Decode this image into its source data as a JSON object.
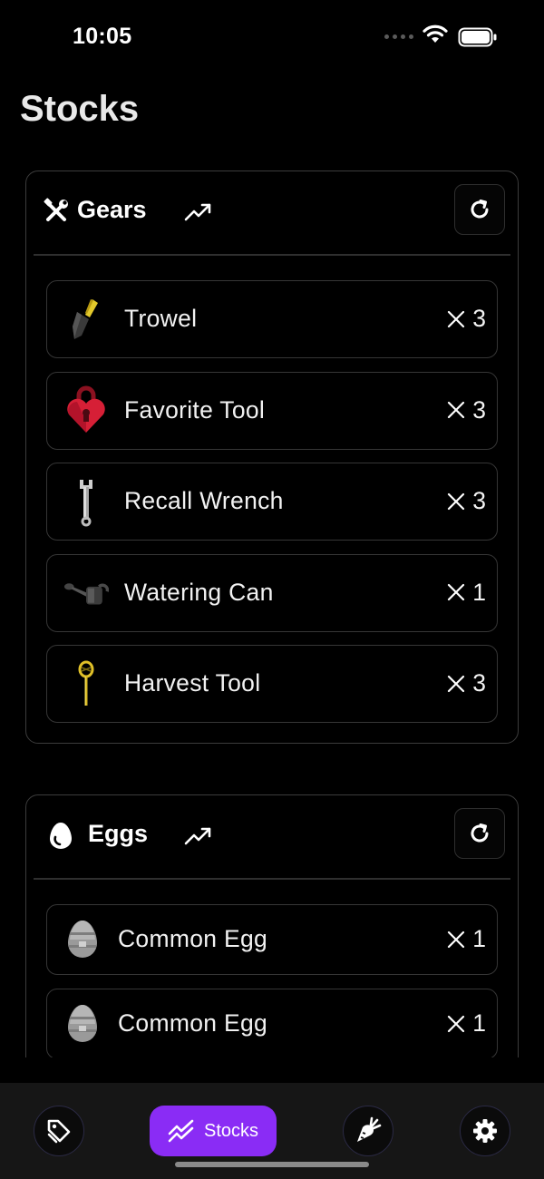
{
  "status_bar": {
    "time": "10:05"
  },
  "page": {
    "title": "Stocks"
  },
  "gears": {
    "title": "Gears",
    "icon": "tools-icon",
    "items": [
      {
        "name": "Trowel",
        "qty": "3",
        "icon": "trowel-icon"
      },
      {
        "name": "Favorite Tool",
        "qty": "3",
        "icon": "heart-lock-icon"
      },
      {
        "name": "Recall Wrench",
        "qty": "3",
        "icon": "wrench-icon"
      },
      {
        "name": "Watering Can",
        "qty": "1",
        "icon": "watering-can-icon"
      },
      {
        "name": "Harvest Tool",
        "qty": "3",
        "icon": "harvest-tool-icon"
      }
    ]
  },
  "eggs": {
    "title": "Eggs",
    "icon": "egg-icon",
    "items": [
      {
        "name": "Common Egg",
        "qty": "1",
        "icon": "common-egg-icon"
      },
      {
        "name": "Common Egg",
        "qty": "1",
        "icon": "common-egg-icon"
      }
    ]
  },
  "tab_bar": {
    "tabs": [
      {
        "icon": "tags-icon",
        "active": false
      },
      {
        "label": "Stocks",
        "icon": "trend-icon",
        "active": true
      },
      {
        "icon": "carrot-icon",
        "active": false
      },
      {
        "icon": "gear-icon",
        "active": false
      }
    ]
  },
  "colors": {
    "accent": "#8a2cf5",
    "background": "#000000",
    "border": "#3c3c3c"
  }
}
